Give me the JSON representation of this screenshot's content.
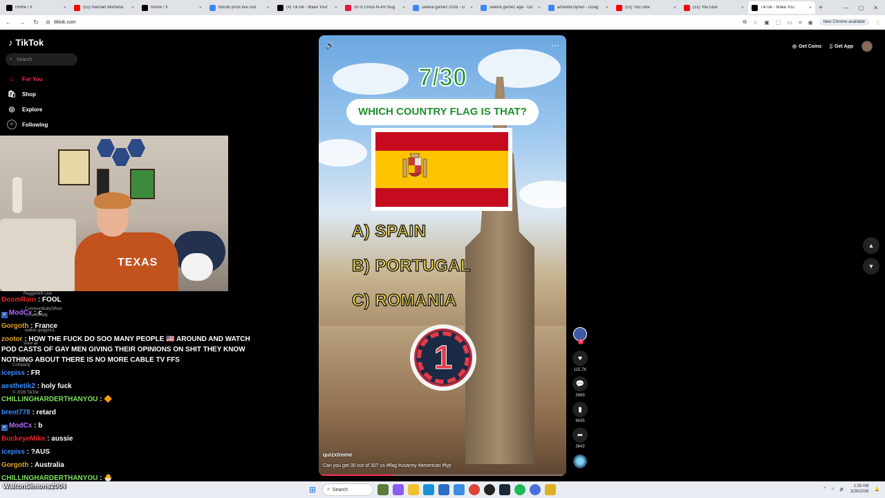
{
  "browser": {
    "tabs": [
      {
        "title": "Home / X",
        "color": "#000000"
      },
      {
        "title": "(51) Hannah Montana",
        "color": "#ff0000"
      },
      {
        "title": "Home / X",
        "color": "#000000"
      },
      {
        "title": "bitcoin price live usd",
        "color": "#4285f4"
      },
      {
        "title": "(4) TikTok - Make Your",
        "color": "#000000"
      },
      {
        "title": "30 ct Chick-fil-A® Nug",
        "color": "#e51636"
      },
      {
        "title": "selena gomez 2026 - G",
        "color": "#4285f4"
      },
      {
        "title": "selena gomez age - Go",
        "color": "#4285f4"
      },
      {
        "title": "amanda bynes - Goog",
        "color": "#4285f4"
      },
      {
        "title": "(51) YouTube",
        "color": "#ff0000"
      },
      {
        "title": "(51) YouTube",
        "color": "#ff0000"
      },
      {
        "title": "TikTok - Make You",
        "color": "#000000",
        "active": true
      }
    ],
    "url": "tiktok.com",
    "update_label": "New Chrome available"
  },
  "sidebar": {
    "logo": "TikTok",
    "search_placeholder": "Search",
    "items": [
      {
        "label": "For You",
        "icon": "home-icon"
      },
      {
        "label": "Shop",
        "icon": "bag-icon"
      },
      {
        "label": "Explore",
        "icon": "compass-icon"
      },
      {
        "label": "Following",
        "icon": "following-icon"
      }
    ],
    "ghost": {
      "reggie": "ReggieWill Live",
      "offset": "CommonBullyOffset",
      "sofia": "sofiaobulally",
      "walton": "walton.goggins1",
      "view_all": "View all",
      "company": "Company",
      "copyright": "© 2026 TikTok"
    }
  },
  "chat": [
    {
      "user": "DoomRain",
      "color": "#e5282d",
      "msg": ": FOOL",
      "mod": false
    },
    {
      "user": "ModCx",
      "color": "#b26bff",
      "msg": ": c",
      "mod": true
    },
    {
      "user": "Gorgoth",
      "color": "#e0a526",
      "msg": ": France",
      "mod": false
    },
    {
      "user": "zootor",
      "color": "#e0a526",
      "msg": ": HOW THE FUCK DO SOO MANY PEOPLE 🇺🇸 AROUND AND WATCH POD CASTS OF GAY MEN GIVING THEIR OPINIONS ON SHIT THEY KNOW NOTHING ABOUT THERE IS NO MORE CABLE TV FFS",
      "mod": false
    },
    {
      "user": "icepiss",
      "color": "#3c8cff",
      "msg": ": FR",
      "mod": false
    },
    {
      "user": "aesthetik2",
      "color": "#3c8cff",
      "msg": ": holy fuck",
      "mod": false
    },
    {
      "user": "CHILLINGHARDERTHANYOU",
      "color": "#7be15d",
      "msg": ": 🔶",
      "mod": false
    },
    {
      "user": "brent778",
      "color": "#3c8cff",
      "msg": ": retard",
      "mod": false
    },
    {
      "user": "ModCx",
      "color": "#b26bff",
      "msg": ": b",
      "mod": true
    },
    {
      "user": "BuckeyeMike",
      "color": "#e5282d",
      "msg": ": aussie",
      "mod": false
    },
    {
      "user": "icepiss",
      "color": "#3c8cff",
      "msg": ": ?AUS",
      "mod": false
    },
    {
      "user": "Gorgoth",
      "color": "#e0a526",
      "msg": ": Australia",
      "mod": false
    },
    {
      "user": "CHILLINGHARDERTHANYOU",
      "color": "#7be15d",
      "msg": ": 🐣",
      "mod": false
    }
  ],
  "video": {
    "counter": "7/30",
    "question": "WHICH COUNTRY FLAG IS THAT?",
    "answers": [
      "A) SPAIN",
      "B) PORTUGAL",
      "C) ROMANIA"
    ],
    "timer": "1",
    "author": "quizxtreme",
    "caption": "Can you get 30 out of 30? us #flag #usarmy #american #fyp",
    "progress": 0.3
  },
  "rail": {
    "likes": "115.7K",
    "comments": "2669",
    "saves": "9435",
    "shares": "3642"
  },
  "top_right": {
    "coins": "Get Coins",
    "app": "Get App"
  },
  "taskbar": {
    "user": "WaltonSimons2004",
    "search": "Search",
    "time": "1:28 AM",
    "date": "3/26/2026"
  }
}
